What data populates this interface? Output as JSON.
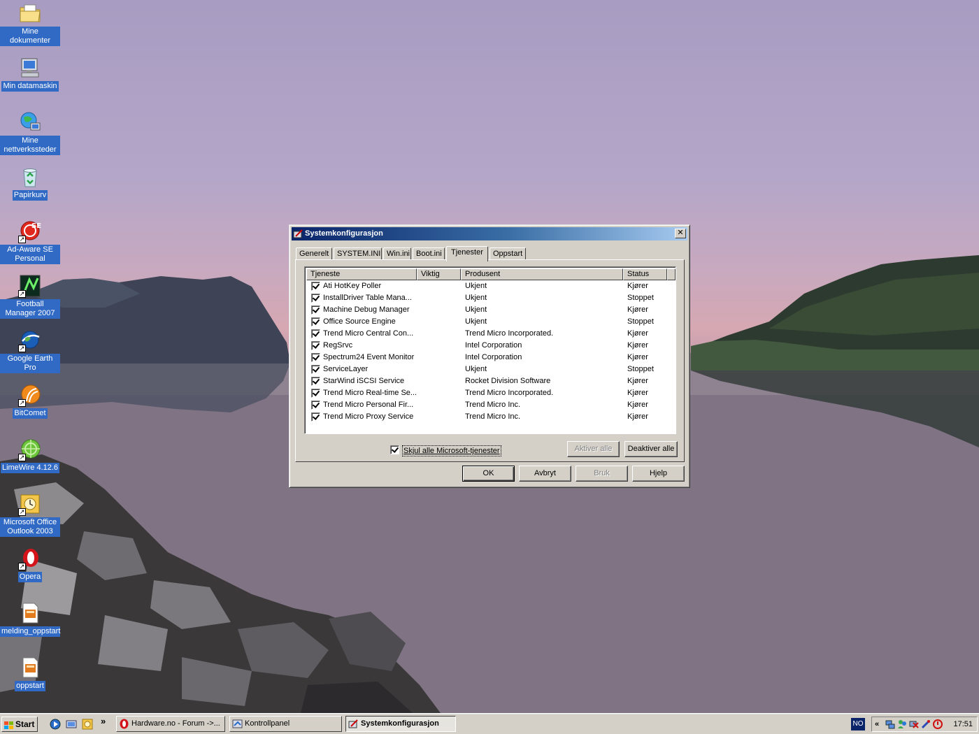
{
  "desktop": {
    "icons": [
      {
        "label": "Mine dokumenter"
      },
      {
        "label": "Min datamaskin"
      },
      {
        "label": "Mine nettverkssteder"
      },
      {
        "label": "Papirkurv"
      },
      {
        "label": "Ad-Aware SE Personal"
      },
      {
        "label": "Football Manager 2007"
      },
      {
        "label": "Google Earth Pro"
      },
      {
        "label": "BitComet"
      },
      {
        "label": "LimeWire 4.12.6"
      },
      {
        "label": "Microsoft Office Outlook 2003"
      },
      {
        "label": "Opera"
      },
      {
        "label": "melding_oppstart"
      },
      {
        "label": "oppstart"
      }
    ]
  },
  "dialog": {
    "title": "Systemkonfigurasjon",
    "close_glyph": "✕",
    "tabs": [
      "Generelt",
      "SYSTEM.INI",
      "Win.ini",
      "Boot.ini",
      "Tjenester",
      "Oppstart"
    ],
    "active_tab": "Tjenester",
    "columns": [
      "Tjeneste",
      "Viktig",
      "Produsent",
      "Status"
    ],
    "services": [
      {
        "name": "Ati HotKey Poller",
        "important": "",
        "manufacturer": "Ukjent",
        "status": "Kjører",
        "checked": true
      },
      {
        "name": "InstallDriver Table Mana...",
        "important": "",
        "manufacturer": "Ukjent",
        "status": "Stoppet",
        "checked": true
      },
      {
        "name": "Machine Debug Manager",
        "important": "",
        "manufacturer": "Ukjent",
        "status": "Kjører",
        "checked": true
      },
      {
        "name": "Office Source Engine",
        "important": "",
        "manufacturer": "Ukjent",
        "status": "Stoppet",
        "checked": true
      },
      {
        "name": "Trend Micro Central Con...",
        "important": "",
        "manufacturer": "Trend Micro Incorporated.",
        "status": "Kjører",
        "checked": true
      },
      {
        "name": "RegSrvc",
        "important": "",
        "manufacturer": "Intel Corporation",
        "status": "Kjører",
        "checked": true
      },
      {
        "name": "Spectrum24 Event Monitor",
        "important": "",
        "manufacturer": "Intel Corporation",
        "status": "Kjører",
        "checked": true
      },
      {
        "name": "ServiceLayer",
        "important": "",
        "manufacturer": "Ukjent",
        "status": "Stoppet",
        "checked": true
      },
      {
        "name": "StarWind iSCSI Service",
        "important": "",
        "manufacturer": "Rocket Division Software",
        "status": "Kjører",
        "checked": true
      },
      {
        "name": "Trend Micro Real-time Se...",
        "important": "",
        "manufacturer": "Trend Micro Incorporated.",
        "status": "Kjører",
        "checked": true
      },
      {
        "name": "Trend Micro Personal Fir...",
        "important": "",
        "manufacturer": "Trend Micro Inc.",
        "status": "Kjører",
        "checked": true
      },
      {
        "name": "Trend Micro Proxy Service",
        "important": "",
        "manufacturer": "Trend Micro Inc.",
        "status": "Kjører",
        "checked": true
      }
    ],
    "hide_ms_label": "Skjul alle Microsoft-tjenester",
    "hide_ms_checked": true,
    "enable_all_label": "Aktiver alle",
    "disable_all_label": "Deaktiver alle",
    "ok_label": "OK",
    "cancel_label": "Avbryt",
    "apply_label": "Bruk",
    "help_label": "Hjelp"
  },
  "taskbar": {
    "start_label": "Start",
    "more_glyph": "»",
    "tasks": [
      {
        "label": "Hardware.no - Forum ->..."
      },
      {
        "label": "Kontrollpanel"
      },
      {
        "label": "Systemkonfigurasjon"
      }
    ],
    "language": "NO",
    "tray_expand_glyph": "«",
    "clock": "17:51"
  }
}
